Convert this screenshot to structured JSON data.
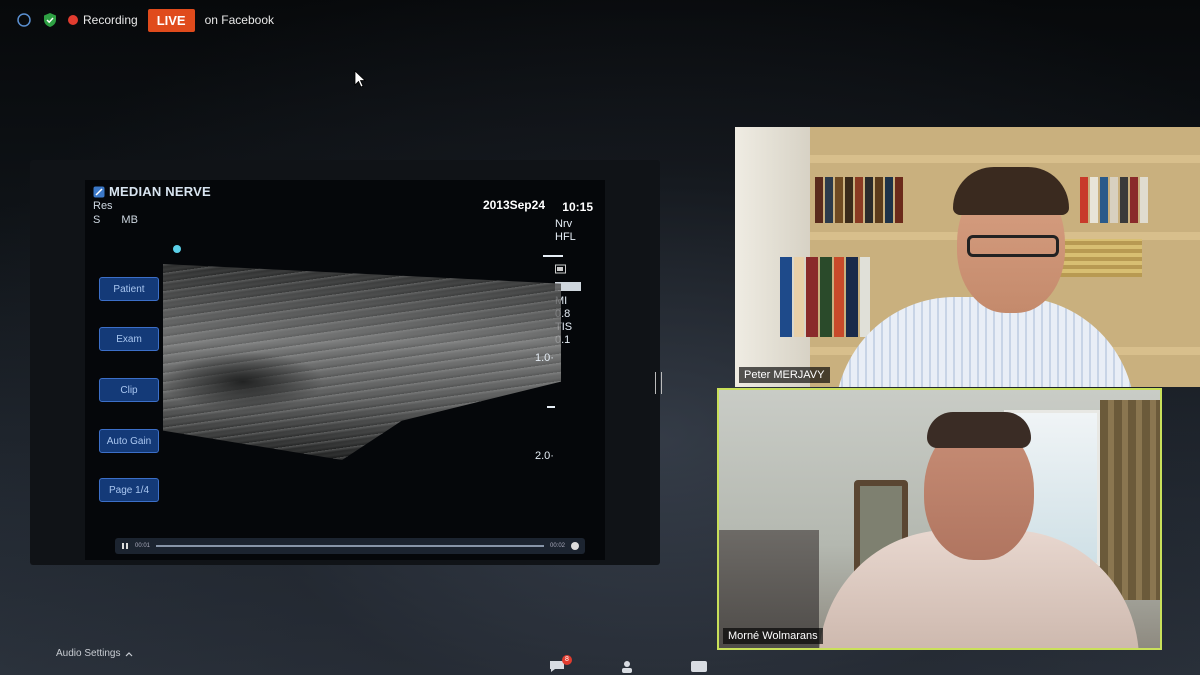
{
  "topbar": {
    "recording_label": "Recording",
    "live_label": "LIVE",
    "facebook_label": "on Facebook"
  },
  "ultrasound": {
    "title": "MEDIAN NERVE",
    "sub_line1": "Res",
    "sub_line2_a": "S",
    "sub_line2_b": "MB",
    "date": "2013Sep24",
    "time": "10:15",
    "side_labels": [
      "Nrv",
      "HFL"
    ],
    "mi_label": "MI",
    "mi_value": "0.8",
    "tis_label": "TIS",
    "tis_value": "0.1",
    "depth_1": "1.0·",
    "depth_2": "2.0·",
    "buttons": [
      "Patient",
      "Exam",
      "Clip",
      "Auto Gain",
      "Page 1/4"
    ],
    "play_time_start": "00:01",
    "play_time_end": "00:02"
  },
  "participants": [
    {
      "name": "Peter MERJAVY"
    },
    {
      "name": "Morné Wolmarans"
    }
  ],
  "toolbar": {
    "audio_settings_label": "Audio Settings",
    "chat_badge": "8"
  },
  "colors": {
    "live": "#e04b1c",
    "active_speaker_border": "#c9e05a",
    "us_button": "#143a78"
  }
}
